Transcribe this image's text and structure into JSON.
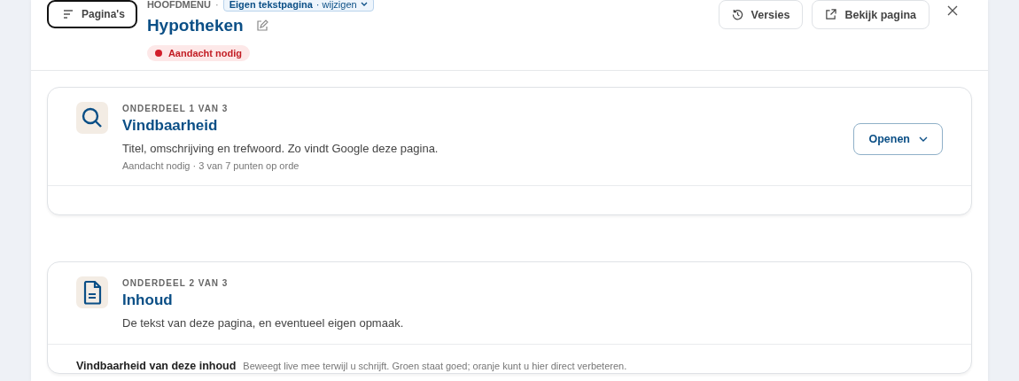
{
  "header": {
    "pages_button": "Pagina's",
    "breadcrumb": "HOOFDMENU",
    "breadcrumb_separator": "·",
    "page_type": "Eigen tekstpagina",
    "page_type_action": "· wijzigen",
    "title": "Hypotheken",
    "status": "Aandacht nodig",
    "actions": [
      "Versies",
      "Bekijk pagina"
    ]
  },
  "sections": [
    {
      "eyebrow": "ONDERDEEL 1 VAN 3",
      "title": "Vindbaarheid",
      "description": "Titel, omschrijving en trefwoord. Zo vindt Google deze pagina.",
      "meta": "Aandacht nodig · 3 van 7 punten op orde",
      "button": "Openen"
    },
    {
      "eyebrow": "ONDERDEEL 2 VAN 3",
      "title": "Inhoud",
      "description": "De tekst van deze pagina, en eventueel eigen opmaak.",
      "sub_title": "Vindbaarheid van deze inhoud",
      "sub_note": "Beweegt live mee terwijl u schrijft. Groen staat goed; oranje kunt u hier direct verbeteren."
    }
  ]
}
